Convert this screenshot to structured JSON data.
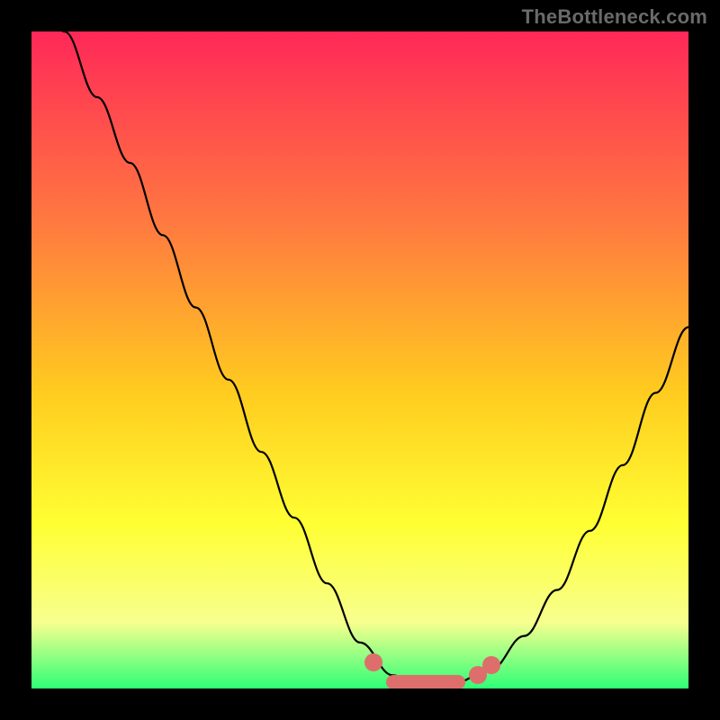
{
  "watermark": "TheBottleneck.com",
  "colors": {
    "accent_pink": "#dd6e6b",
    "gradient_top": "#ff2858",
    "gradient_mid1": "#ff7c3f",
    "gradient_mid2": "#ffcc1f",
    "gradient_mid3": "#ffff33",
    "gradient_mid4": "#f7ff8f",
    "gradient_bottom": "#2eff76"
  },
  "chart_data": {
    "type": "line",
    "title": "",
    "xlabel": "",
    "ylabel": "",
    "xlim": [
      0,
      100
    ],
    "ylim": [
      0,
      100
    ],
    "x": [
      0,
      5,
      10,
      15,
      20,
      25,
      30,
      35,
      40,
      45,
      50,
      55,
      58,
      60,
      62,
      65,
      68,
      70,
      75,
      80,
      85,
      90,
      95,
      100
    ],
    "values": [
      110,
      100,
      90,
      80,
      69,
      58,
      47,
      36,
      26,
      16,
      7,
      2,
      1,
      1,
      1,
      1,
      2,
      3,
      8,
      15,
      24,
      34,
      45,
      55
    ],
    "annotations": [
      {
        "kind": "pill",
        "x_start": 54,
        "x_end": 66,
        "y": 1,
        "color": "accent_pink"
      },
      {
        "kind": "dot",
        "x": 52,
        "y": 4,
        "color": "accent_pink"
      },
      {
        "kind": "dot",
        "x": 68,
        "y": 2,
        "color": "accent_pink"
      },
      {
        "kind": "dot",
        "x": 70,
        "y": 3.5,
        "color": "accent_pink"
      }
    ]
  }
}
